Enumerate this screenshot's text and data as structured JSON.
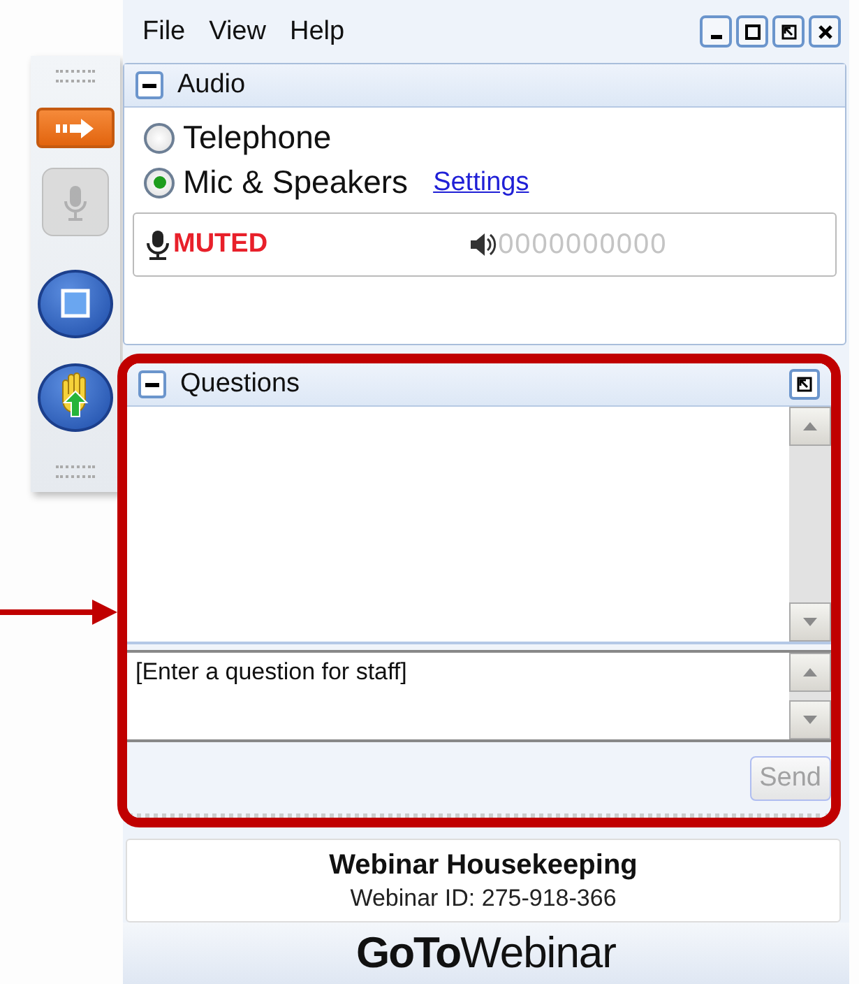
{
  "menu": [
    "File",
    "View",
    "Help"
  ],
  "window_controls": [
    {
      "kind": "minimize"
    },
    {
      "kind": "maximize"
    },
    {
      "kind": "popout"
    },
    {
      "kind": "close"
    }
  ],
  "toolbar": [
    {
      "kind": "show"
    },
    {
      "kind": "mic",
      "disabled": true
    },
    {
      "kind": "screen"
    },
    {
      "kind": "hand"
    }
  ],
  "audio": {
    "title": "Audio",
    "options": [
      {
        "label": "Telephone",
        "selected": false
      },
      {
        "label": "Mic & Speakers",
        "selected": true
      }
    ],
    "settings_link": "Settings",
    "mic_status": "MUTED",
    "speaker_meter": "0000000000"
  },
  "questions": {
    "title": "Questions",
    "placeholder": "[Enter a question for staff]",
    "send_button": "Send",
    "send_disabled": true
  },
  "footer": {
    "title": "Webinar Housekeeping",
    "webinar_id": "Webinar ID: 275-918-366",
    "logo": "**GoTo**Webinar"
  }
}
